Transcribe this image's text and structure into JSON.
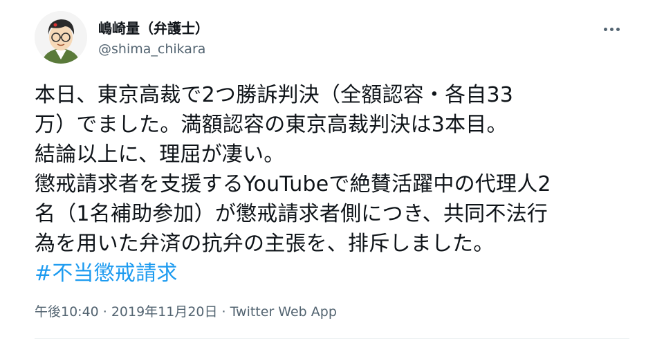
{
  "user": {
    "display_name": "嶋崎量（弁護士）",
    "handle": "@shima_chikara"
  },
  "tweet": {
    "text": "本日、東京高裁で2つ勝訴判決（全額認容・各自33\n万）でました。満額認容の東京高裁判決は3本目。\n結論以上に、理屈が凄い。\n懲戒請求者を支援するYouTubeで絶賛活躍中の代理人2\n名（1名補助参加）が懲戒請求者側につき、共同不法行\n為を用いた弁済の抗弁の主張を、排斥しました。",
    "hashtag": "#不当懲戒請求"
  },
  "meta": {
    "time": "午後10:40",
    "separator": "·",
    "date": "2019年11月20日",
    "source": "Twitter Web App"
  },
  "colors": {
    "text": "#0f1419",
    "secondary": "#536471",
    "link": "#1d9bf0"
  },
  "icons": {
    "more": "more-horizontal-icon"
  }
}
